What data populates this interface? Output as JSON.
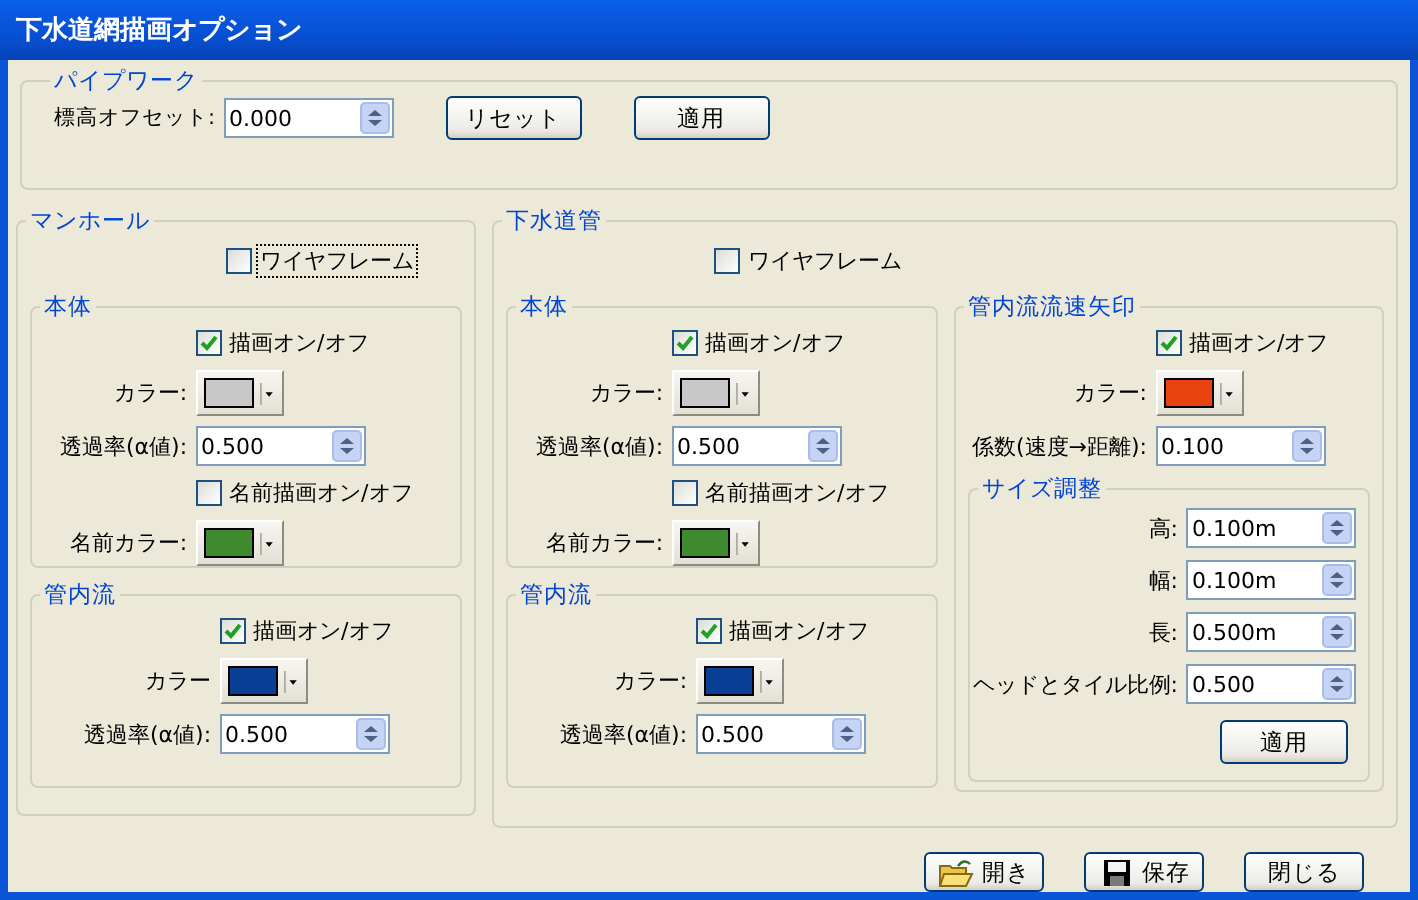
{
  "window": {
    "title": "下水道網描画オプション"
  },
  "pipework": {
    "title": "パイプワーク",
    "offset": {
      "label": "標高オフセット:",
      "value": "0.000"
    },
    "buttons": [
      "リセット",
      "適用"
    ]
  },
  "manhole": {
    "title": "マンホール",
    "wireframe": {
      "label": "ワイヤフレーム",
      "checked": false,
      "focused": true
    },
    "sections": [
      {
        "title": "本体",
        "rows": [
          {
            "kind": "checkbox",
            "label": "描画オン/オフ",
            "checked": true
          },
          {
            "kind": "color",
            "label": "カラー:",
            "color": "#c8c8c8"
          },
          {
            "kind": "spin",
            "label": "透過率(α値):",
            "value": "0.500"
          },
          {
            "kind": "checkbox",
            "label": "名前描画オン/オフ",
            "checked": false
          },
          {
            "kind": "color",
            "label": "名前カラー:",
            "color": "#3f8a2e"
          }
        ]
      },
      {
        "title": "管内流",
        "rows": [
          {
            "kind": "checkbox",
            "label": "描画オン/オフ",
            "checked": true
          },
          {
            "kind": "color",
            "label": "カラー",
            "color": "#0a3f96"
          },
          {
            "kind": "spin",
            "label": "透過率(α値):",
            "value": "0.500"
          }
        ]
      }
    ]
  },
  "sewer_pipe": {
    "title": "下水道管",
    "wireframe": {
      "label": "ワイヤフレーム",
      "checked": false,
      "focused": false
    },
    "sections": [
      {
        "title": "本体",
        "rows": [
          {
            "kind": "checkbox",
            "label": "描画オン/オフ",
            "checked": true
          },
          {
            "kind": "color",
            "label": "カラー:",
            "color": "#c8c8c8"
          },
          {
            "kind": "spin",
            "label": "透過率(α値):",
            "value": "0.500"
          },
          {
            "kind": "checkbox",
            "label": "名前描画オン/オフ",
            "checked": false
          },
          {
            "kind": "color",
            "label": "名前カラー:",
            "color": "#3f8a2e"
          }
        ]
      },
      {
        "title": "管内流",
        "rows": [
          {
            "kind": "checkbox",
            "label": "描画オン/オフ",
            "checked": true
          },
          {
            "kind": "color",
            "label": "カラー:",
            "color": "#0a3f96"
          },
          {
            "kind": "spin",
            "label": "透過率(α値):",
            "value": "0.500"
          }
        ]
      }
    ],
    "arrow": {
      "title": "管内流流速矢印",
      "rows": [
        {
          "kind": "checkbox",
          "label": "描画オン/オフ",
          "checked": true
        },
        {
          "kind": "color",
          "label": "カラー:",
          "color": "#e8420f"
        },
        {
          "kind": "spin",
          "label": "係数(速度→距離):",
          "value": "0.100"
        }
      ],
      "size": {
        "title": "サイズ調整",
        "rows": [
          {
            "kind": "spin",
            "label": "高:",
            "value": "0.100m"
          },
          {
            "kind": "spin",
            "label": "幅:",
            "value": "0.100m"
          },
          {
            "kind": "spin",
            "label": "長:",
            "value": "0.500m"
          },
          {
            "kind": "spin",
            "label": "ヘッドとタイル比例:",
            "value": "0.500"
          }
        ],
        "button": "適用"
      }
    }
  },
  "footer_buttons": [
    {
      "label": "開き"
    },
    {
      "label": "保存"
    },
    {
      "label": "閉じる"
    }
  ]
}
